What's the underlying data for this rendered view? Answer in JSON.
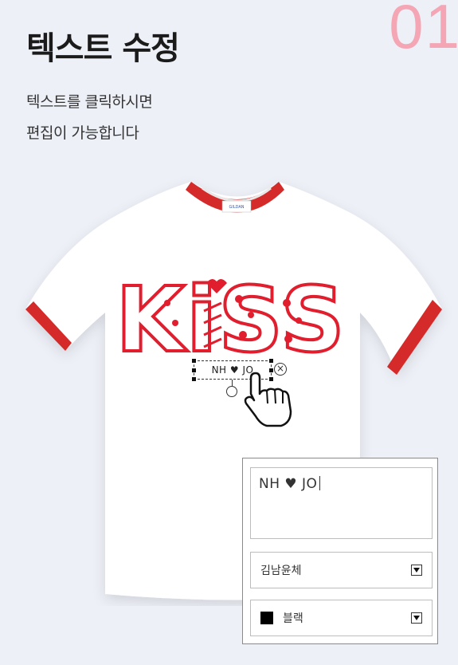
{
  "step_number": "01",
  "title": "텍스트 수정",
  "description": [
    "텍스트를 클릭하시면",
    "편집이 가능합니다"
  ],
  "shirt": {
    "print_text": "KiSS",
    "edit_text": "NH ♥ JO",
    "tag_brand": "GILDAN",
    "body_color": "#ffffff",
    "trim_color": "#d42a2a"
  },
  "panel": {
    "text_value": "NH ♥ JO",
    "font_select": "김남윤체",
    "color_select": "블랙",
    "color_swatch": "#000000"
  },
  "icons": [
    "close-icon",
    "rotate-icon",
    "hand-cursor-icon",
    "dropdown-arrow-icon"
  ]
}
